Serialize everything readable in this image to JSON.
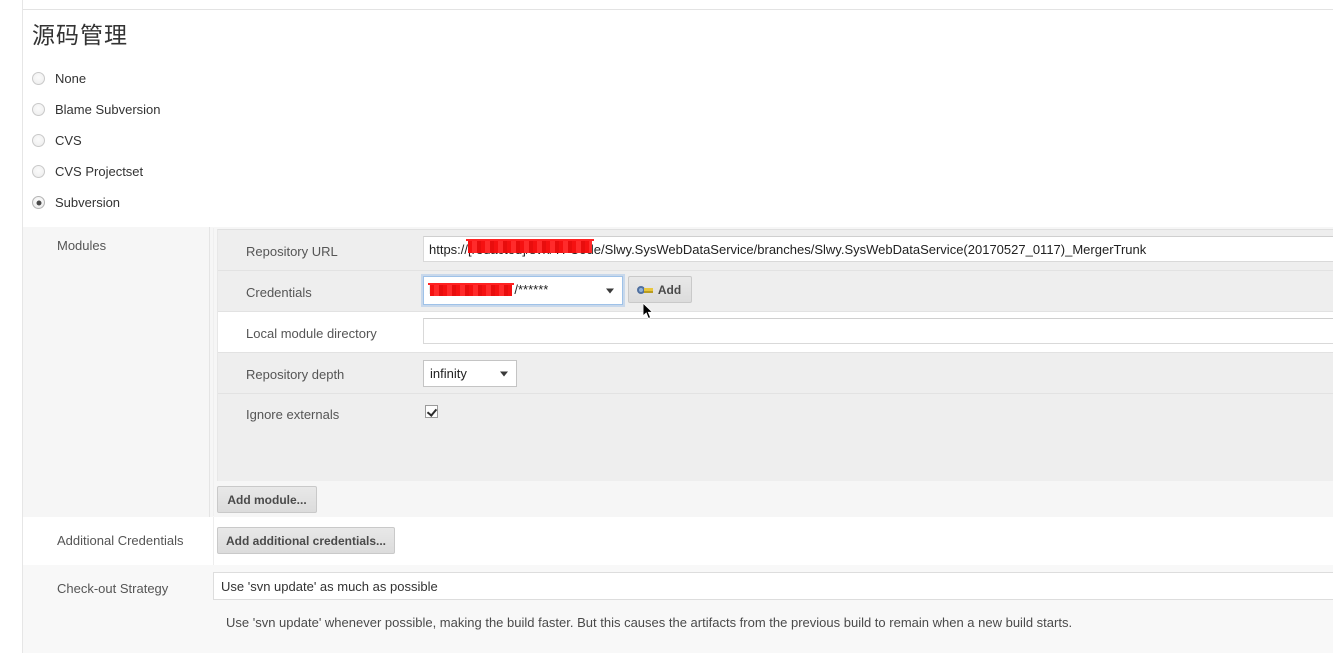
{
  "page": {
    "title": "源码管理"
  },
  "scm": {
    "options": [
      {
        "label": "None",
        "selected": false
      },
      {
        "label": "Blame Subversion",
        "selected": false
      },
      {
        "label": "CVS",
        "selected": false
      },
      {
        "label": "CVS Projectset",
        "selected": false
      },
      {
        "label": "Subversion",
        "selected": true
      }
    ]
  },
  "modules": {
    "label": "Modules",
    "fields": {
      "repository_url": {
        "label": "Repository URL",
        "value": "https://                     /svn/YFCode/Slwy.SysWebDataService/branches/Slwy.SysWebDataService(20170527_0117)_MergerTrunk",
        "value_plain": "https://[redacted]/svn/YFCode/Slwy.SysWebDataService/branches/Slwy.SysWebDataService(20170527_0117)_MergerTrunk",
        "redacted": true
      },
      "credentials": {
        "label": "Credentials",
        "value": "h              /******",
        "value_plain": "[redacted]/******",
        "redacted": true,
        "add_button": "Add",
        "add_button_icon": "key-icon"
      },
      "local_module_directory": {
        "label": "Local module directory",
        "value": "",
        "placeholder": ""
      },
      "repository_depth": {
        "label": "Repository depth",
        "value": "infinity"
      },
      "ignore_externals": {
        "label": "Ignore externals",
        "checked": true
      }
    },
    "add_module_button": "Add module..."
  },
  "additional_credentials": {
    "label": "Additional Credentials",
    "button": "Add additional credentials..."
  },
  "checkout_strategy": {
    "label": "Check-out Strategy",
    "value": "Use 'svn update' as much as possible",
    "help": "Use 'svn update' whenever possible, making the build faster. But this causes the artifacts from the previous build to remain when a new build starts."
  },
  "colors": {
    "redaction": "#ff1a1a",
    "row_gray": "#eeeeee",
    "panel_bg": "#f6f6f6",
    "focus_blue": "#9fc2e8"
  }
}
